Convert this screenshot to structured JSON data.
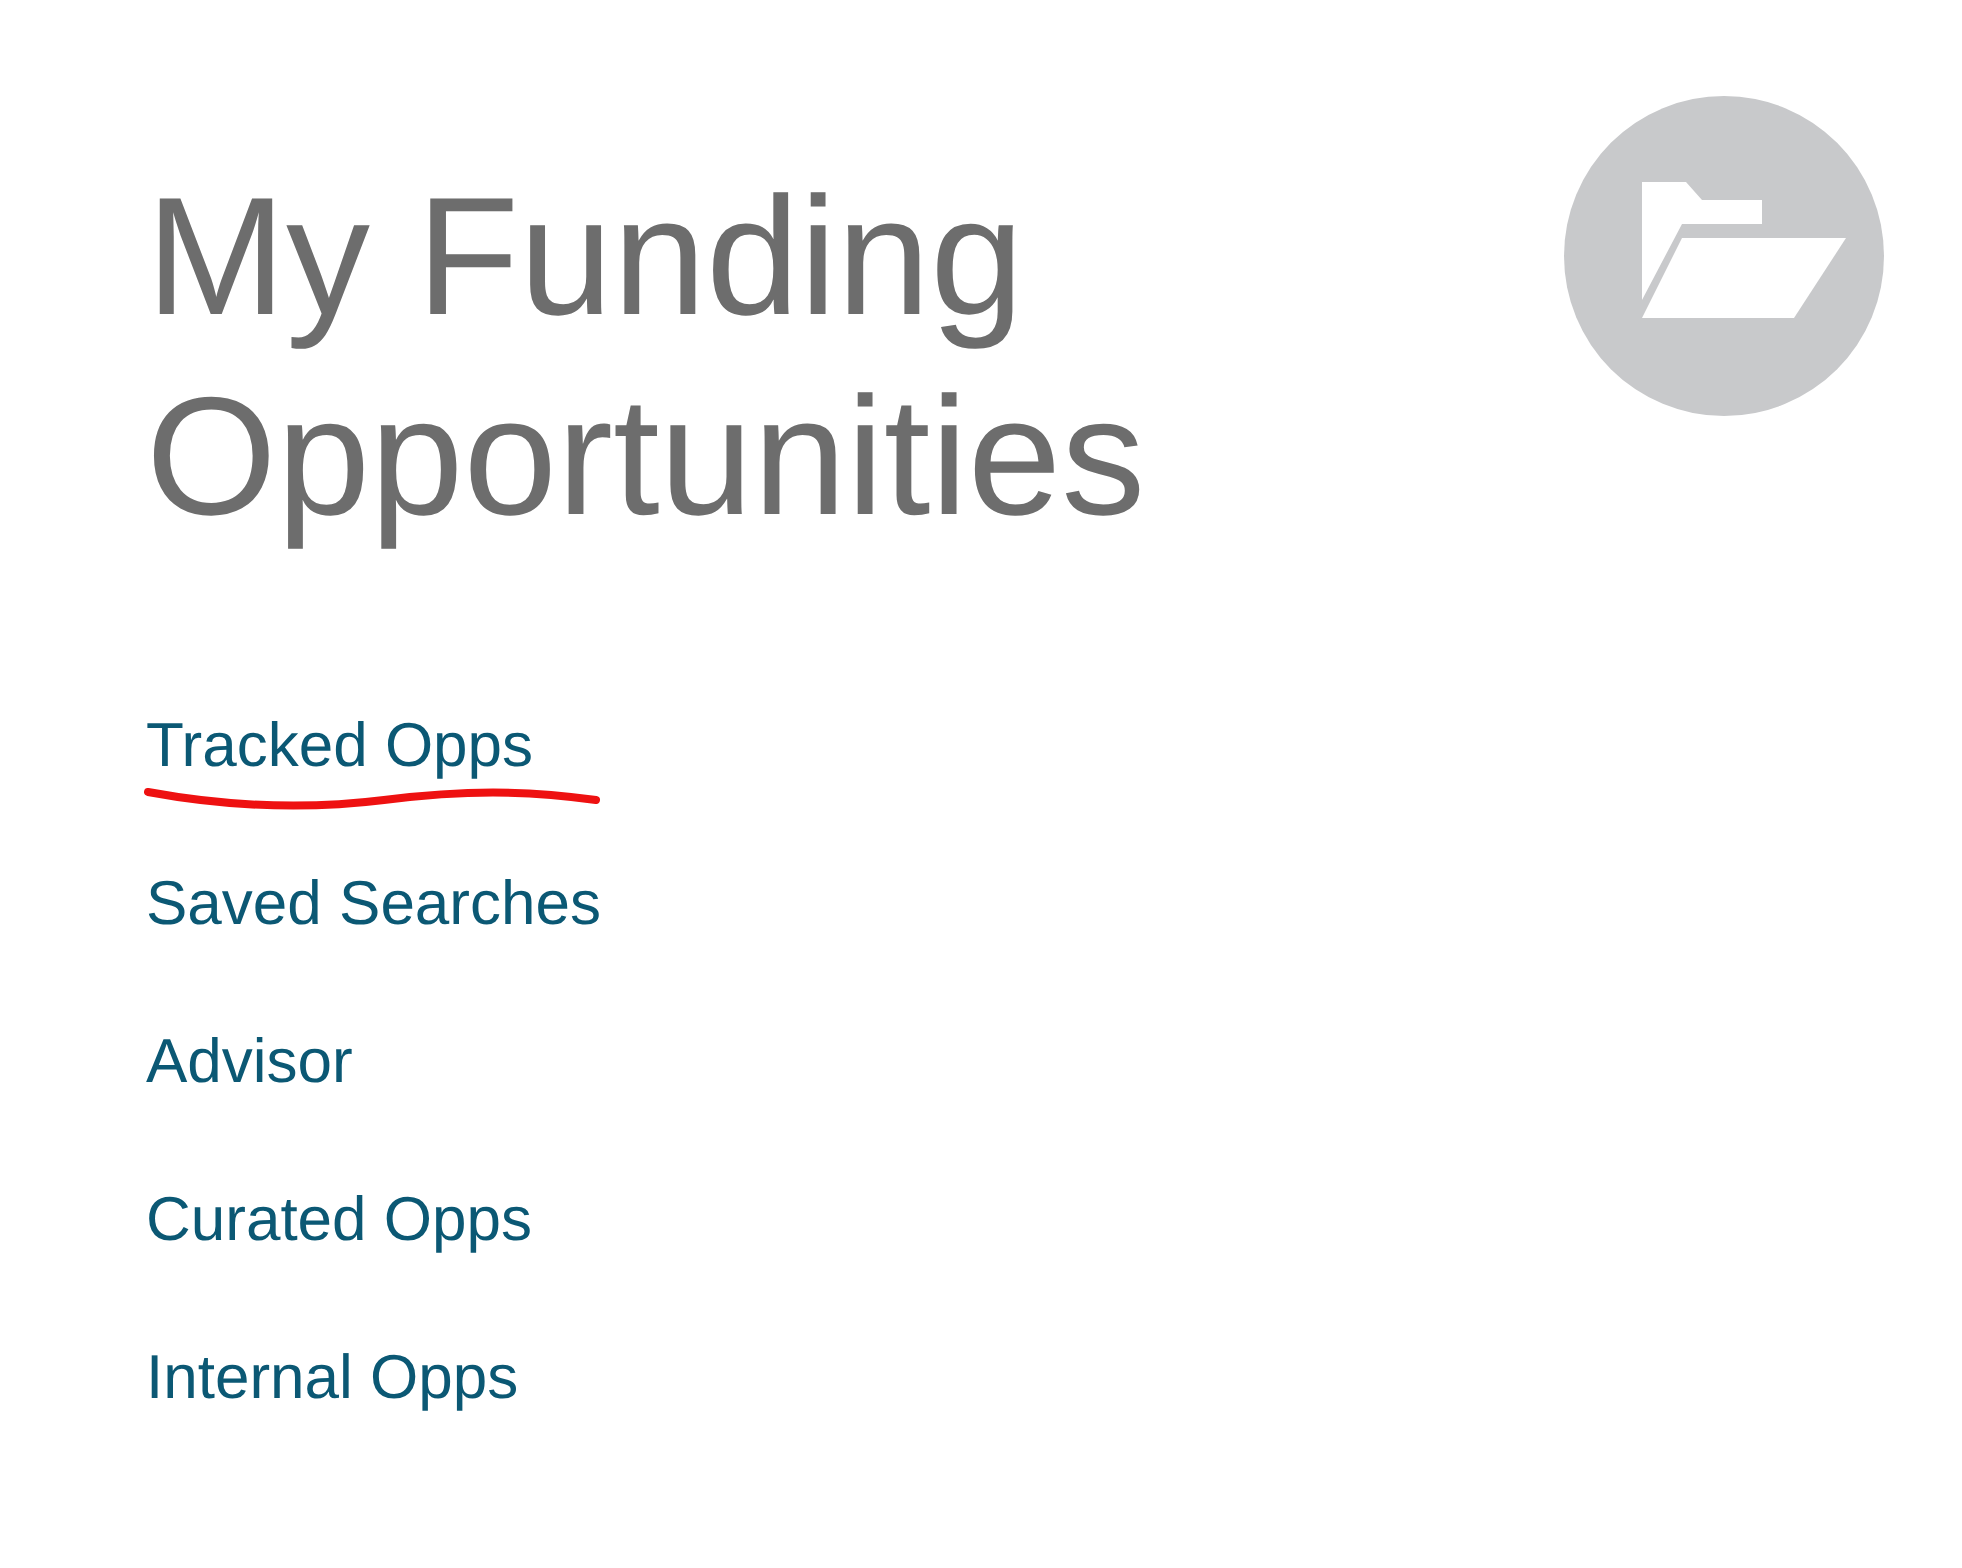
{
  "title": "My Funding Opportunities",
  "links": [
    {
      "label": "Tracked Opps",
      "annotated": true
    },
    {
      "label": "Saved Searches",
      "annotated": false
    },
    {
      "label": "Advisor",
      "annotated": false
    },
    {
      "label": "Curated Opps",
      "annotated": false
    },
    {
      "label": "Internal Opps",
      "annotated": false
    }
  ]
}
